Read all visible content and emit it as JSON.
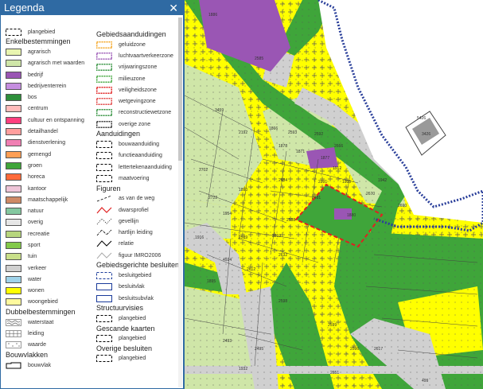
{
  "legend": {
    "title": "Legenda",
    "close_icon": "close-icon",
    "top": [
      {
        "label": "plangebied",
        "style": "dash-black"
      }
    ],
    "sections_left": [
      {
        "heading": "Enkelbestemmingen",
        "items": [
          {
            "label": "agrarisch",
            "color": "#e9f5b0"
          },
          {
            "label": "agrarisch met waarden",
            "color": "#cfe6a8"
          },
          {
            "label": "bedrijf",
            "color": "#9a56b4"
          },
          {
            "label": "bedrijventerrein",
            "color": "#c58ee0"
          },
          {
            "label": "bos",
            "color": "#2d8f3a"
          },
          {
            "label": "centrum",
            "color": "#ffbcbc"
          },
          {
            "label": "cultuur en ontspanning",
            "color": "#ff3f7f"
          },
          {
            "label": "detailhandel",
            "color": "#ff9e9e"
          },
          {
            "label": "dienstverlening",
            "color": "#f07fb3"
          },
          {
            "label": "gemengd",
            "color": "#ff9f55"
          },
          {
            "label": "groen",
            "color": "#3fa53a"
          },
          {
            "label": "horeca",
            "color": "#ff6a3a"
          },
          {
            "label": "kantoor",
            "color": "#eec5d8"
          },
          {
            "label": "maatschappelijk",
            "color": "#cf8a66"
          },
          {
            "label": "natuur",
            "color": "#84c8a0"
          },
          {
            "label": "overig",
            "color": "#e6e6e6"
          },
          {
            "label": "recreatie",
            "color": "#b7d67e"
          },
          {
            "label": "sport",
            "color": "#82c94a"
          },
          {
            "label": "tuin",
            "color": "#c9e08a"
          },
          {
            "label": "verkeer",
            "color": "#d0d0d0"
          },
          {
            "label": "water",
            "color": "#9fd3ea"
          },
          {
            "label": "wonen",
            "color": "#ffff00"
          },
          {
            "label": "woongebied",
            "color": "#fffa9e"
          }
        ]
      },
      {
        "heading": "Dubbelbestemmingen",
        "items": [
          {
            "label": "waterstaat",
            "style": "pattern-wave"
          },
          {
            "label": "leiding",
            "style": "pattern-grid"
          },
          {
            "label": "waarde",
            "style": "pattern-dots"
          }
        ]
      },
      {
        "heading": "Bouwvlakken",
        "items": [
          {
            "label": "bouwvlak",
            "style": "bouwvlak"
          }
        ]
      }
    ],
    "sections_right": [
      {
        "heading": "Gebiedsaanduidingen",
        "items": [
          {
            "label": "geluidzone",
            "style": "zone",
            "color": "#f5a623"
          },
          {
            "label": "luchtvaartverkeerzone",
            "style": "zone",
            "color": "#9a56b4"
          },
          {
            "label": "vrijwaringszone",
            "style": "zone",
            "color": "#2d8f3a"
          },
          {
            "label": "milieuzone",
            "style": "zone",
            "color": "#3fa53a"
          },
          {
            "label": "veiligheidszone",
            "style": "zone",
            "color": "#e02020"
          },
          {
            "label": "wetgevingzone",
            "style": "zone",
            "color": "#e04040"
          },
          {
            "label": "reconstructiewetzone",
            "style": "zone",
            "color": "#2d8f3a"
          },
          {
            "label": "overige zone",
            "style": "zone",
            "color": "#333333"
          }
        ]
      },
      {
        "heading": "Aanduidingen",
        "items": [
          {
            "label": "bouwaanduiding",
            "style": "dash-black"
          },
          {
            "label": "functieaanduiding",
            "style": "dash-black"
          },
          {
            "label": "lettertekenaanduiding",
            "style": "dash-black"
          },
          {
            "label": "maatvoering",
            "style": "dash-black"
          }
        ]
      },
      {
        "heading": "Figuren",
        "items": [
          {
            "label": "as van de weg",
            "style": "line-dash"
          },
          {
            "label": "dwarsprofiel",
            "style": "line-red"
          },
          {
            "label": "gevellijn",
            "style": "line-dot"
          },
          {
            "label": "hartlijn leiding",
            "style": "line-dashdot"
          },
          {
            "label": "relatie",
            "style": "line-black"
          },
          {
            "label": "figuur IMRO2006",
            "style": "line-grey"
          }
        ]
      },
      {
        "heading": "Gebiedsgerichte besluiten",
        "items": [
          {
            "label": "besluitgebied",
            "style": "dash-blue"
          },
          {
            "label": "besluitvlak",
            "style": "box-blue"
          },
          {
            "label": "besluitsubvlak",
            "style": "box-blue"
          }
        ]
      },
      {
        "heading": "Structuurvisies",
        "items": [
          {
            "label": "plangebied",
            "style": "dash-black"
          }
        ]
      },
      {
        "heading": "Gescande kaarten",
        "items": [
          {
            "label": "plangebied",
            "style": "dash-black"
          }
        ]
      },
      {
        "heading": "Overige besluiten",
        "items": [
          {
            "label": "plangebied",
            "style": "dash-black"
          }
        ]
      }
    ]
  },
  "map": {
    "parcel_numbers": [
      "2585",
      "1886",
      "2192",
      "1878",
      "1871",
      "1866",
      "2593",
      "2592",
      "1877",
      "1912",
      "1935",
      "1942",
      "2684",
      "1890",
      "2391",
      "2481",
      "1880",
      "2588",
      "2619",
      "2632",
      "2589",
      "2612",
      "1895",
      "4924",
      "2598",
      "2599",
      "2596",
      "2617",
      "499",
      "1932",
      "2493",
      "2495",
      "2651",
      "2666",
      "2670",
      "2690",
      "2702",
      "2722",
      "1954",
      "1916",
      "5426",
      "3426",
      "3459"
    ],
    "colors": {
      "wonen": "#ffff00",
      "groen": "#3fa53a",
      "bos": "#2d8f3a",
      "verkeer": "#d0d0d0",
      "agrarisch": "#cfe6a8",
      "bedrijf": "#9a56b4",
      "plangebied": "#e02020",
      "zone": "#2a3f9a"
    }
  }
}
